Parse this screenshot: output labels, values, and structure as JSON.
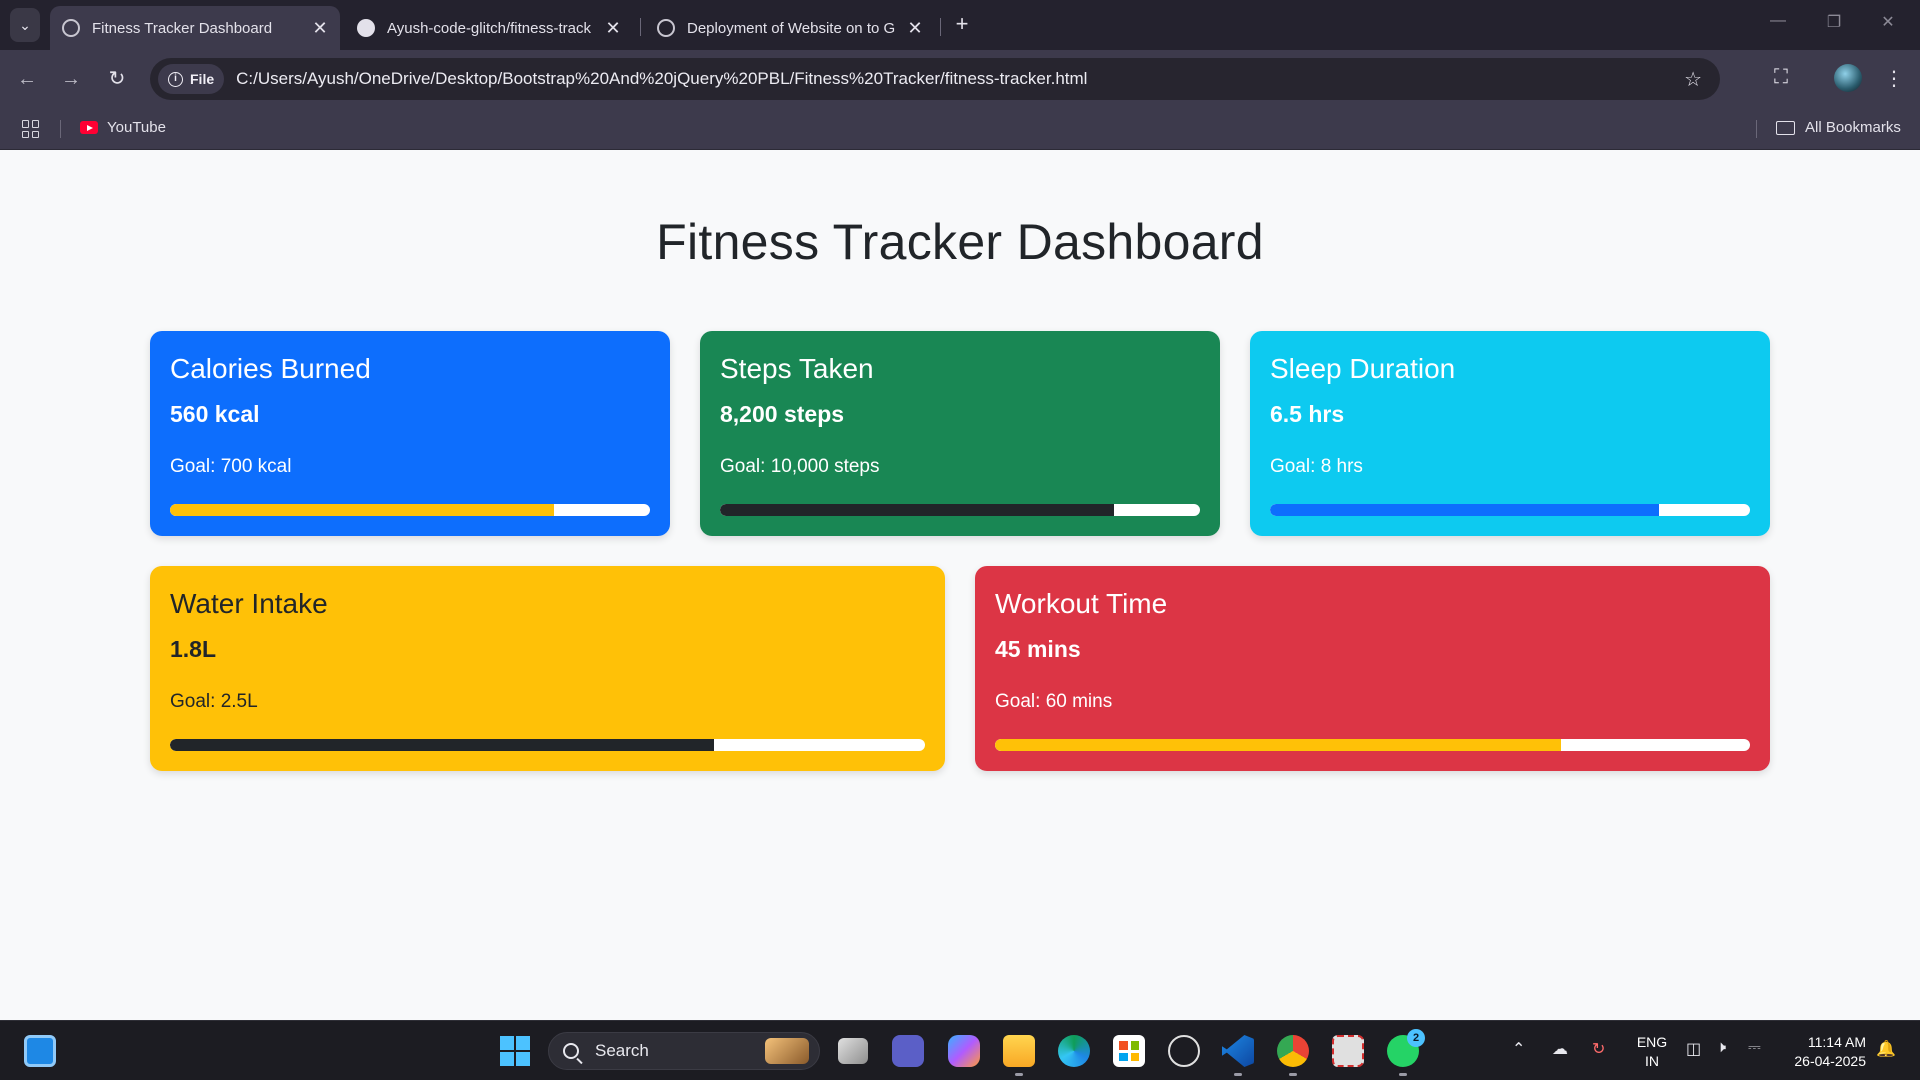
{
  "browser": {
    "tabs": [
      {
        "title": "Fitness Tracker Dashboard",
        "active": true,
        "icon": "globe-icon"
      },
      {
        "title": "Ayush-code-glitch/fitness-track",
        "active": false,
        "icon": "github-icon"
      },
      {
        "title": "Deployment of Website on to G",
        "active": false,
        "icon": "globe-icon"
      }
    ],
    "chip_label": "File",
    "url": "C:/Users/Ayush/OneDrive/Desktop/Bootstrap%20And%20jQuery%20PBL/Fitness%20Tracker/fitness-tracker.html",
    "bookmarks": {
      "youtube": "YouTube",
      "all": "All Bookmarks"
    }
  },
  "page": {
    "title": "Fitness Tracker Dashboard",
    "cards": [
      {
        "title": "Calories Burned",
        "value": "560 kcal",
        "goal": "Goal: 700 kcal",
        "progress": 0.8,
        "bg": "#0d6efd",
        "fg": "#ffffff",
        "bar": "#ffc107"
      },
      {
        "title": "Steps Taken",
        "value": "8,200 steps",
        "goal": "Goal: 10,000 steps",
        "progress": 0.82,
        "bg": "#198754",
        "fg": "#ffffff",
        "bar": "#212529"
      },
      {
        "title": "Sleep Duration",
        "value": "6.5 hrs",
        "goal": "Goal: 8 hrs",
        "progress": 0.81,
        "bg": "#0dcaf0",
        "fg": "#ffffff",
        "bar": "#0d6efd"
      },
      {
        "title": "Water Intake",
        "value": "1.8L",
        "goal": "Goal: 2.5L",
        "progress": 0.72,
        "bg": "#ffc107",
        "fg": "#212529",
        "bar": "#212529"
      },
      {
        "title": "Workout Time",
        "value": "45 mins",
        "goal": "Goal: 60 mins",
        "progress": 0.75,
        "bg": "#dc3545",
        "fg": "#ffffff",
        "bar": "#ffc107"
      }
    ]
  },
  "taskbar": {
    "search_label": "Search",
    "lang_top": "ENG",
    "lang_bottom": "IN",
    "time": "11:14 AM",
    "date": "26-04-2025",
    "whatsapp_badge": "2"
  }
}
